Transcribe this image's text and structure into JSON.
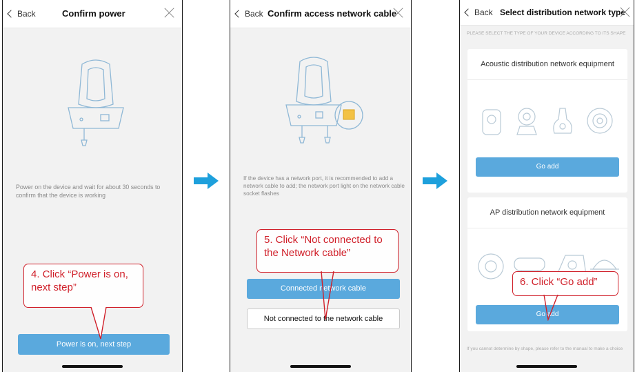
{
  "screens": [
    {
      "back_label": "Back",
      "title": "Confirm power",
      "description": "Power on the device and wait for about 30 seconds to confirm that the device is working",
      "primary_button": "Power is on, next step",
      "callout": "4. Click “Power is on, next step”"
    },
    {
      "back_label": "Back",
      "title": "Confirm access network cable",
      "description": "If the device has a network port, it is recommended to add a network cable to add; the network port light on the network cable socket flashes",
      "primary_button": "Connected network cable",
      "secondary_button": "Not connected to the network cable",
      "callout": "5. Click “Not connected to the Network cable”"
    },
    {
      "back_label": "Back",
      "title": "Select distribution network type",
      "hint": "Please select the type of your device according to its shape",
      "card1_title": "Acoustic distribution network equipment",
      "card1_button": "Go add",
      "card2_title": "AP distribution network equipment",
      "card2_button": "Go add",
      "footer_hint": "If you cannot determine by shape, please refer to the manual to make a choice",
      "callout": "6. Click “Go add”"
    }
  ],
  "colors": {
    "primary_button": "#5aa9dd",
    "callout": "#d0202a",
    "flow_arrow": "#1ea0dc"
  },
  "icons": [
    "back-chevron-icon",
    "close-icon",
    "camera-illustration-icon",
    "flow-arrow-icon"
  ]
}
